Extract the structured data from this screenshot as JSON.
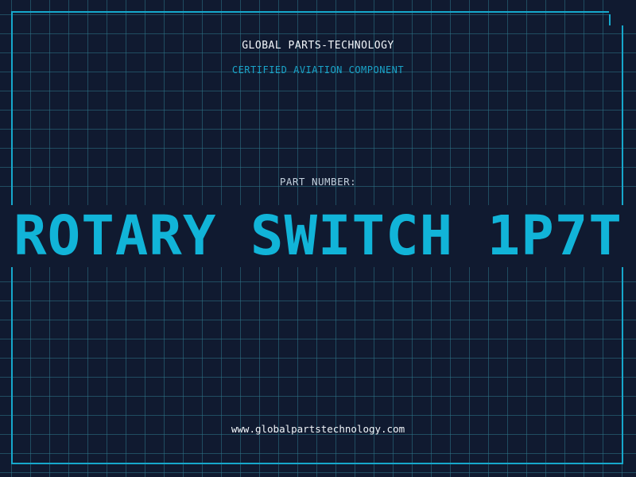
{
  "header": {
    "company": "GLOBAL PARTS-TECHNOLOGY",
    "subtitle": "CERTIFIED AVIATION COMPONENT"
  },
  "part": {
    "label": "PART NUMBER:",
    "value": "ROTARY SWITCH 1P7T"
  },
  "footer": {
    "url": "www.globalpartstechnology.com"
  },
  "colors": {
    "background": "#101a30",
    "grid": "#2e7488",
    "accent": "#16a8cc",
    "text": "#f2f6fa"
  }
}
